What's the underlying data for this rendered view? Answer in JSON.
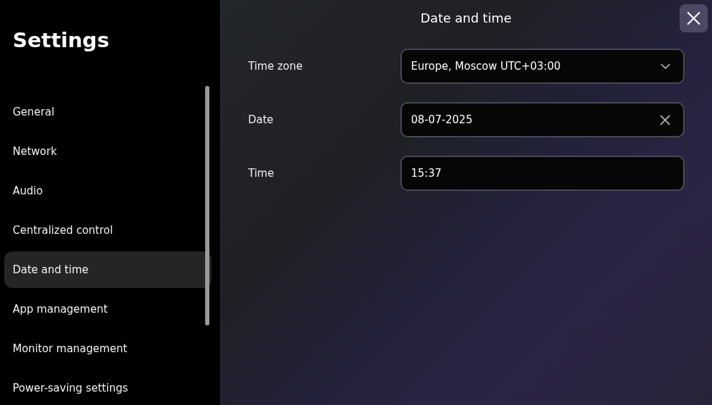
{
  "sidebar": {
    "title": "Settings",
    "items": [
      {
        "label": "General",
        "selected": false
      },
      {
        "label": "Network",
        "selected": false
      },
      {
        "label": "Audio",
        "selected": false
      },
      {
        "label": "Centralized control",
        "selected": false
      },
      {
        "label": "Date and time",
        "selected": true
      },
      {
        "label": "App management",
        "selected": false
      },
      {
        "label": "Monitor management",
        "selected": false
      },
      {
        "label": "Power-saving settings",
        "selected": false
      }
    ]
  },
  "panel": {
    "title": "Date and time",
    "fields": [
      {
        "label": "Time zone",
        "kind": "dropdown",
        "value": "Europe, Moscow UTC+03:00"
      },
      {
        "label": "Date",
        "kind": "clearable",
        "value": "08-07-2025"
      },
      {
        "label": "Time",
        "kind": "text",
        "value": "15:37"
      }
    ]
  }
}
